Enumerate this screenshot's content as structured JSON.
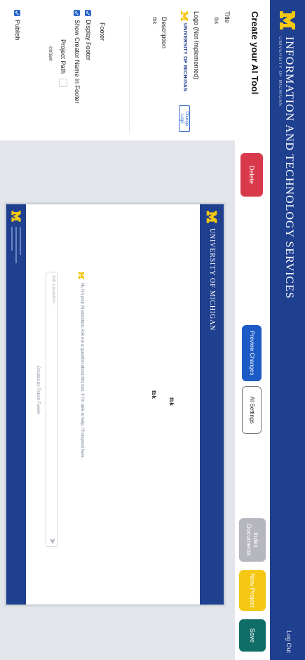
{
  "header": {
    "title": "INFORMATION AND TECHNOLOGY SERVICES",
    "subtitle": "UNIVERSITY OF MICHIGAN",
    "user": "Log Out"
  },
  "toolbar": {
    "page_title": "Create your AI Tool",
    "delete_label": "Delete",
    "preview_label": "Preview Changes",
    "ai_settings_label": "AI Settings",
    "index_documents_label": "Index Documents",
    "new_project_label": "New Project",
    "save_label": "Save"
  },
  "settings": {
    "title_label": "Title",
    "title_value": "tbk",
    "logo_label": "Logo (Not Implemented)",
    "logo_wordmark": "UNIVERSITY OF MICHIGAN",
    "change_logo_label": "Change Logo",
    "description_label": "Description",
    "description_value": "tbk",
    "footer_label": "Footer",
    "display_footer_label": "Display Footer",
    "show_creator_label": "Show Creator Name in Footer",
    "project_path_label": "Project Path",
    "project_path_value": "cetaw",
    "publish_label": "Publish"
  },
  "preview": {
    "header_title": "UNIVERSITY OF MICHIGAN",
    "tool_name": "tbk",
    "tool_description": "tbk",
    "welcome_text": "Hi, I'm your AI assistant. Ask me a question about this tool. If I'm able to help, I'll respond here.",
    "input_placeholder": "Ask a question...",
    "created_by": "Created by Robert Fueller"
  },
  "colors": {
    "brand_blue": "#1f3f8f",
    "maize": "#f3c712",
    "delete_red": "#d93a4b",
    "save_teal": "#116d67",
    "action_blue": "#1c5bc5"
  }
}
